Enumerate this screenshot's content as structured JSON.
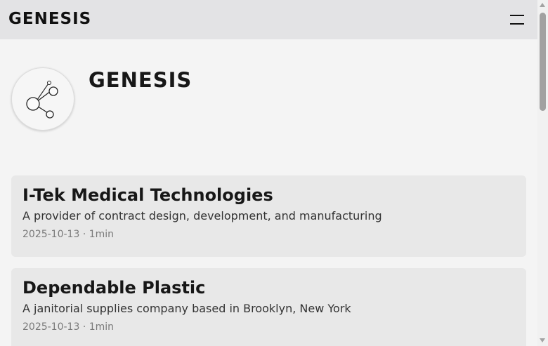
{
  "header": {
    "brand": "GENESIS",
    "menu_icon": "hamburger-menu-icon"
  },
  "profile": {
    "avatar_icon": "share-network-icon",
    "title": "GENESIS"
  },
  "posts": [
    {
      "title": "I-Tek Medical Technologies",
      "description": "A provider of contract design, development, and manufacturing",
      "date": "2025-10-13",
      "separator": "·",
      "reading_time": "1min"
    },
    {
      "title": "Dependable Plastic",
      "description": "A janitorial supplies company based in Brooklyn, New York",
      "date": "2025-10-13",
      "separator": "·",
      "reading_time": "1min"
    }
  ],
  "colors": {
    "page_background": "#f4f4f4",
    "header_background": "#e3e3e5",
    "card_background": "#e8e8e8",
    "meta_text": "#7a7a7a"
  }
}
